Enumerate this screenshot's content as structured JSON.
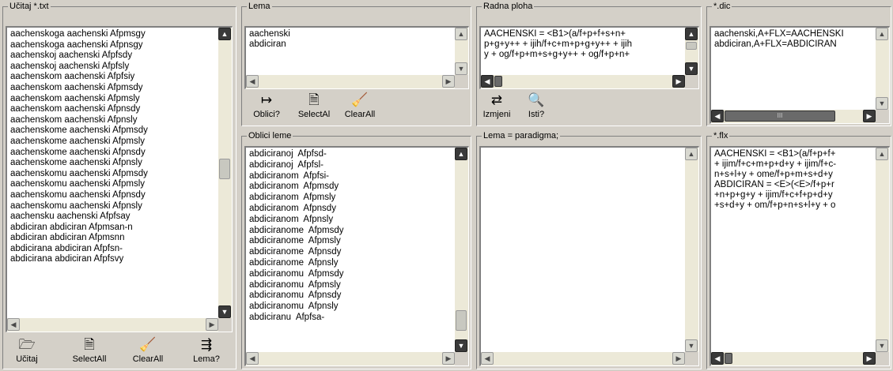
{
  "ucitaj": {
    "title": "Učitaj *.txt",
    "lines": [
      "aachenskoga aachenski Afpmsgy",
      "aachenskoga aachenski Afpnsgy",
      "aachenskoj aachenski Afpfsdy",
      "aachenskoj aachenski Afpfsly",
      "aachenskom aachenski Afpfsiy",
      "aachenskom aachenski Afpmsdy",
      "aachenskom aachenski Afpmsly",
      "aachenskom aachenski Afpnsdy",
      "aachenskom aachenski Afpnsly",
      "aachenskome aachenski Afpmsdy",
      "aachenskome aachenski Afpmsly",
      "aachenskome aachenski Afpnsdy",
      "aachenskome aachenski Afpnsly",
      "aachenskomu aachenski Afpmsdy",
      "aachenskomu aachenski Afpmsly",
      "aachenskomu aachenski Afpnsdy",
      "aachenskomu aachenski Afpnsly",
      "aachensku aachenski Afpfsay",
      "abdiciran abdiciran Afpmsan-n",
      "abdiciran abdiciran Afpmsnn",
      "abdicirana abdiciran Afpfsn-",
      "abdicirana abdiciran Afpfsvy"
    ],
    "buttons": [
      "Učitaj",
      "SelectAll",
      "ClearAll",
      "Lema?"
    ]
  },
  "lema": {
    "title": "Lema",
    "lines": [
      "aachenski",
      "abdiciran"
    ],
    "buttons": [
      "Oblici?",
      "SelectAl",
      "ClearAll"
    ]
  },
  "oblici": {
    "title": "Oblici leme",
    "lines": [
      "abdiciranoj  Afpfsd-",
      "abdiciranoj  Afpfsl-",
      "abdiciranom  Afpfsi-",
      "abdiciranom  Afpmsdy",
      "abdiciranom  Afpmsly",
      "abdiciranom  Afpnsdy",
      "abdiciranom  Afpnsly",
      "abdiciranome  Afpmsdy",
      "abdiciranome  Afpmsly",
      "abdiciranome  Afpnsdy",
      "abdiciranome  Afpnsly",
      "abdiciranomu  Afpmsdy",
      "abdiciranomu  Afpmsly",
      "abdiciranomu  Afpnsdy",
      "abdiciranomu  Afpnsly",
      "abdiciranu  Afpfsa-"
    ]
  },
  "radna": {
    "title": "Radna ploha",
    "lines": [
      "AACHENSKI = <B1>(a/f+p+f+s+n+",
      "p+g+y++ + ijih/f+c+m+p+g+y++ + ijih",
      "y + og/f+p+m+s+g+y++ + og/f+p+n+"
    ],
    "buttons": [
      "Izmjeni",
      "Isti?"
    ]
  },
  "paradigma": {
    "title": "Lema = paradigma;"
  },
  "dic": {
    "title": "*.dic",
    "lines": [
      "aachenski,A+FLX=AACHENSKI",
      "abdiciran,A+FLX=ABDICIRAN"
    ],
    "scroll_label": "III"
  },
  "flx": {
    "title": "*.flx",
    "lines": [
      "AACHENSKI = <B1>(a/f+p+f+",
      "+ ijim/f+c+m+p+d+y + ijim/f+c-",
      "n+s+l+y + ome/f+p+m+s+d+y",
      "ABDICIRAN = <E>(<E>/f+p+r",
      "+n+p+g+y + ijim/f+c+f+p+d+y",
      "+s+d+y + om/f+p+n+s+l+y + o"
    ]
  },
  "icons": [
    "open-folder-icon",
    "document-icon",
    "broom-icon",
    "lemma-icon",
    "arrow-forward-icon",
    "exchange-icon",
    "magnifier-icon"
  ]
}
